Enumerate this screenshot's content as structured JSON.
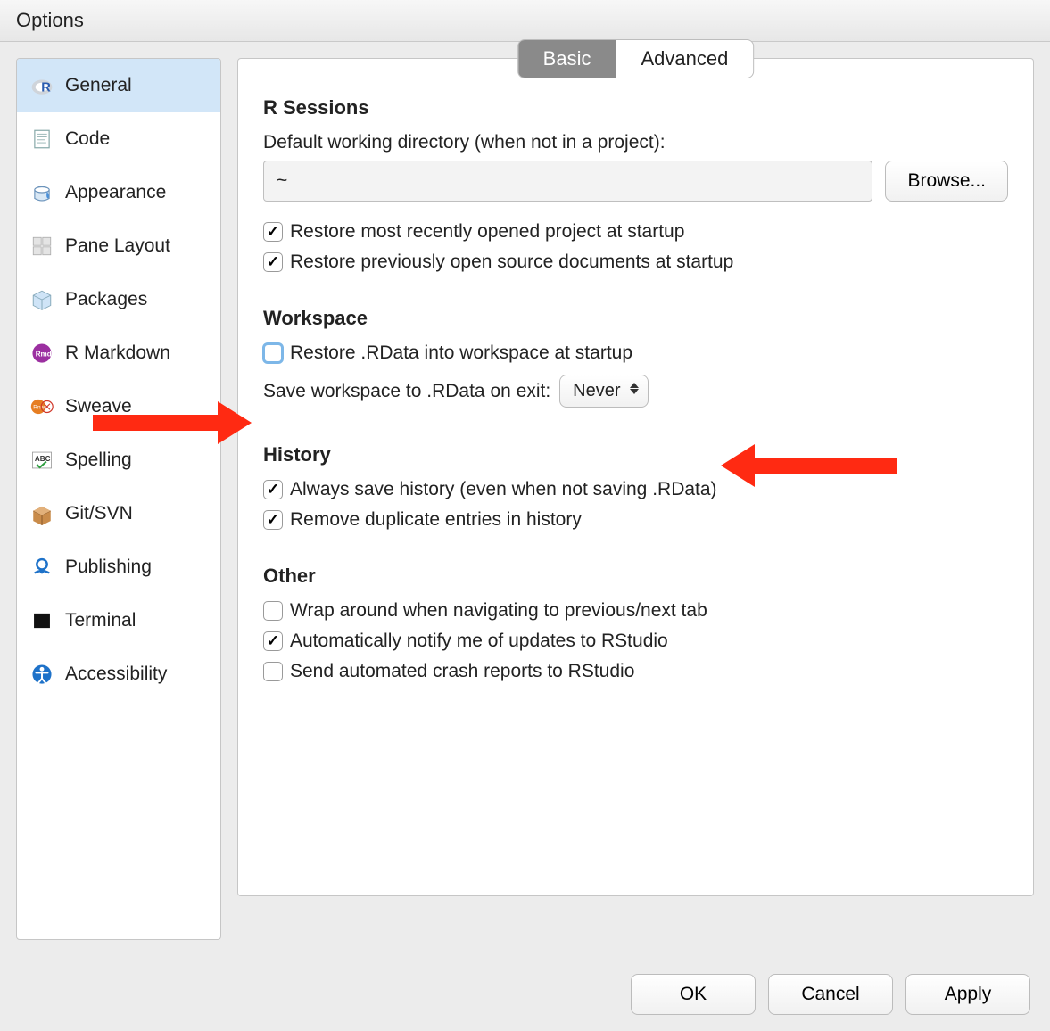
{
  "title": "Options",
  "sidebar": {
    "items": [
      {
        "label": "General",
        "icon": "r-logo-icon",
        "selected": true
      },
      {
        "label": "Code",
        "icon": "document-icon",
        "selected": false
      },
      {
        "label": "Appearance",
        "icon": "paint-bucket-icon",
        "selected": false
      },
      {
        "label": "Pane Layout",
        "icon": "grid-icon",
        "selected": false
      },
      {
        "label": "Packages",
        "icon": "box-icon",
        "selected": false
      },
      {
        "label": "R Markdown",
        "icon": "rmd-icon",
        "selected": false
      },
      {
        "label": "Sweave",
        "icon": "rnw-icon",
        "selected": false
      },
      {
        "label": "Spelling",
        "icon": "abc-check-icon",
        "selected": false
      },
      {
        "label": "Git/SVN",
        "icon": "cardboard-box-icon",
        "selected": false
      },
      {
        "label": "Publishing",
        "icon": "cloud-publish-icon",
        "selected": false
      },
      {
        "label": "Terminal",
        "icon": "terminal-icon",
        "selected": false
      },
      {
        "label": "Accessibility",
        "icon": "accessibility-icon",
        "selected": false
      }
    ]
  },
  "tabs": {
    "basic": "Basic",
    "advanced": "Advanced",
    "active": "basic"
  },
  "sections": {
    "rsessions": {
      "title": "R Sessions",
      "defaultDirLabel": "Default working directory (when not in a project):",
      "defaultDirValue": "~",
      "browse": "Browse...",
      "restoreProject": {
        "label": "Restore most recently opened project at startup",
        "checked": true
      },
      "restoreDocs": {
        "label": "Restore previously open source documents at startup",
        "checked": true
      }
    },
    "workspace": {
      "title": "Workspace",
      "restoreRData": {
        "label": "Restore .RData into workspace at startup",
        "checked": false
      },
      "saveOnExitLabel": "Save workspace to .RData on exit:",
      "saveOnExitValue": "Never"
    },
    "history": {
      "title": "History",
      "alwaysSave": {
        "label": "Always save history (even when not saving .RData)",
        "checked": true
      },
      "removeDup": {
        "label": "Remove duplicate entries in history",
        "checked": true
      }
    },
    "other": {
      "title": "Other",
      "wrap": {
        "label": "Wrap around when navigating to previous/next tab",
        "checked": false
      },
      "notify": {
        "label": "Automatically notify me of updates to RStudio",
        "checked": true
      },
      "crash": {
        "label": "Send automated crash reports to RStudio",
        "checked": false
      }
    }
  },
  "footer": {
    "ok": "OK",
    "cancel": "Cancel",
    "apply": "Apply"
  }
}
